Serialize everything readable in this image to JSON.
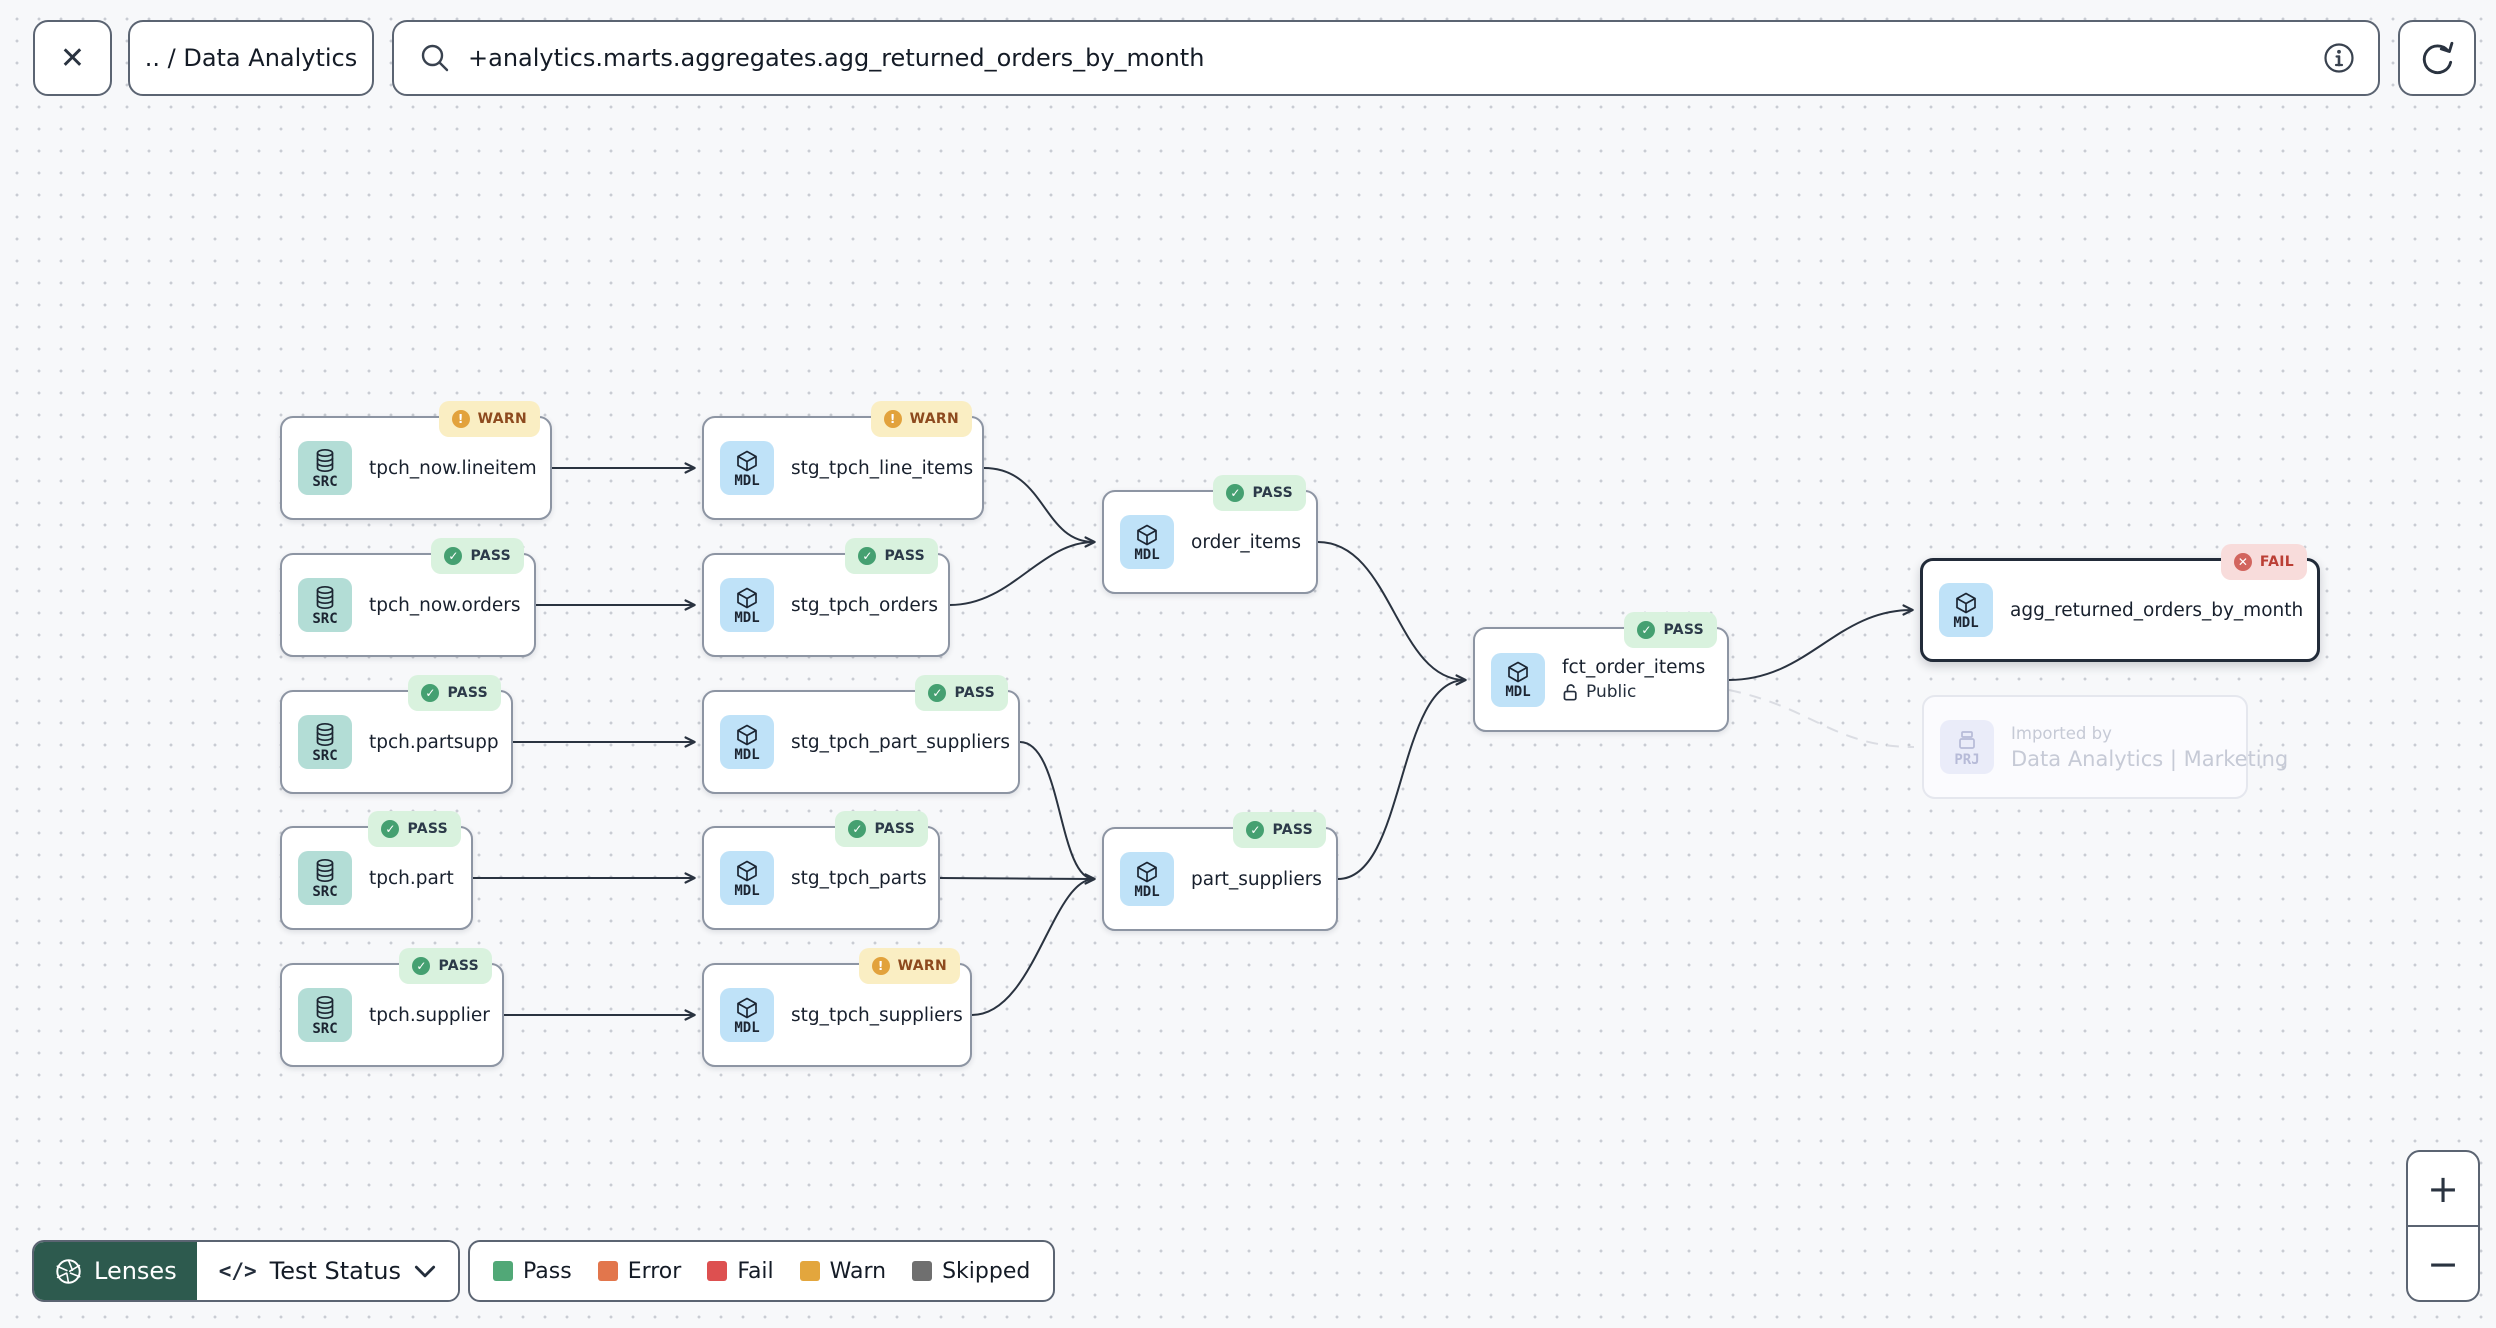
{
  "header": {
    "close_icon": "✕",
    "breadcrumb": ".. / Data Analytics",
    "search_value": "+analytics.marts.aggregates.agg_returned_orders_by_month"
  },
  "nodes": [
    {
      "label": "tpch_now.lineitem",
      "type": "SRC",
      "status": "WARN"
    },
    {
      "label": "stg_tpch_line_items",
      "type": "MDL",
      "status": "WARN"
    },
    {
      "label": "tpch_now.orders",
      "type": "SRC",
      "status": "PASS"
    },
    {
      "label": "stg_tpch_orders",
      "type": "MDL",
      "status": "PASS"
    },
    {
      "label": "order_items",
      "type": "MDL",
      "status": "PASS"
    },
    {
      "label": "fct_order_items",
      "type": "MDL",
      "status": "PASS",
      "sublabel": "Public"
    },
    {
      "label": "agg_returned_orders_by_month",
      "type": "MDL",
      "status": "FAIL"
    },
    {
      "label": "Data Analytics | Marketing",
      "type": "PRJ",
      "sublabel": "Imported by"
    },
    {
      "label": "tpch.partsupp",
      "type": "SRC",
      "status": "PASS"
    },
    {
      "label": "stg_tpch_part_suppliers",
      "type": "MDL",
      "status": "PASS"
    },
    {
      "label": "tpch.part",
      "type": "SRC",
      "status": "PASS"
    },
    {
      "label": "stg_tpch_parts",
      "type": "MDL",
      "status": "PASS"
    },
    {
      "label": "part_suppliers",
      "type": "MDL",
      "status": "PASS"
    },
    {
      "label": "tpch.supplier",
      "type": "SRC",
      "status": "PASS"
    },
    {
      "label": "stg_tpch_suppliers",
      "type": "MDL",
      "status": "WARN"
    }
  ],
  "footer": {
    "lenses_label": "Lenses",
    "code_icon": "</>",
    "lens_name": "Test Status",
    "legend": [
      {
        "label": "Pass",
        "color": "#51a877"
      },
      {
        "label": "Error",
        "color": "#e2764c"
      },
      {
        "label": "Fail",
        "color": "#dd5050"
      },
      {
        "label": "Warn",
        "color": "#e3a63d"
      },
      {
        "label": "Skipped",
        "color": "#6f6f6f"
      }
    ]
  },
  "zoom": {
    "in": "+",
    "out": "−"
  }
}
